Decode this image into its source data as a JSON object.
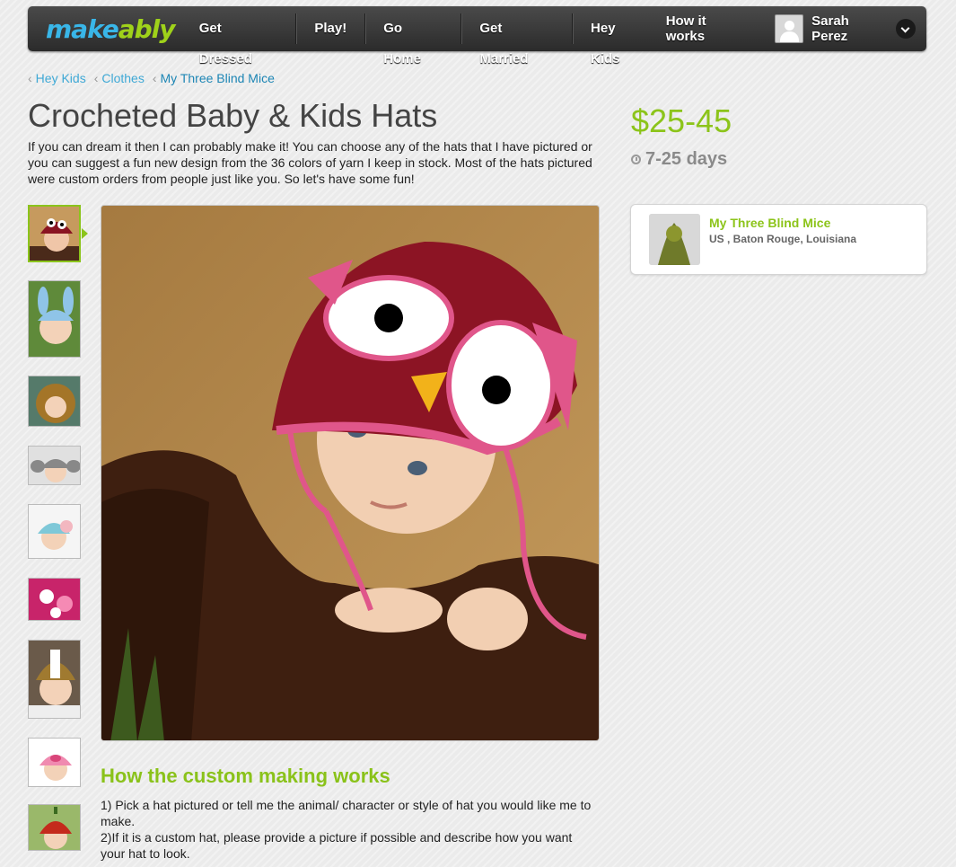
{
  "nav": {
    "logo_part1": "make",
    "logo_part2": "ably",
    "items": [
      "Get Dressed",
      "Play!",
      "Go Home",
      "Get Married",
      "Hey Kids"
    ],
    "how": "How it works",
    "user": "Sarah Perez"
  },
  "breadcrumb": [
    "Hey Kids",
    "Clothes",
    "My Three Blind Mice"
  ],
  "product": {
    "title": "Crocheted Baby & Kids Hats",
    "description": "If you can dream it then I can probably make it! You can choose any of the hats that I have pictured or you can suggest a fun new design from the 36 colors of yarn I keep in stock. Most of the hats pictured were custom orders from people just like you. So let's have some fun!",
    "price": "$25-45",
    "days": "7-25 days"
  },
  "seller": {
    "name": "My Three Blind Mice",
    "location": "US , Baton Rouge, Louisiana"
  },
  "how": {
    "title": "How the custom making works",
    "step1": "1) Pick a hat pictured or tell me the animal/ character or style of hat you would like me to make.",
    "step2": "2)If it is a custom hat, please provide a picture if possible and describe how you want your hat to look."
  },
  "colors": {
    "accent": "#8cc41a",
    "link": "#3fa9d6",
    "nav": "#2b2b2b"
  }
}
